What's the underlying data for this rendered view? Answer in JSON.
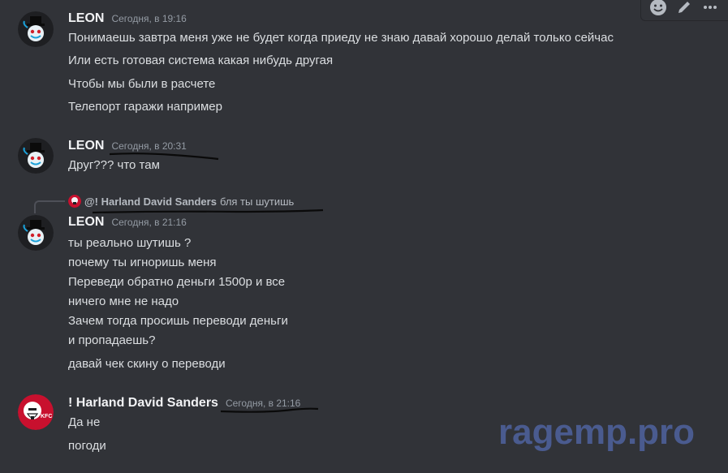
{
  "toolbar": {
    "icons": [
      "emoji-icon",
      "edit-icon",
      "more-icon"
    ]
  },
  "messages": [
    {
      "username": "LEON",
      "timestamp": "Сегодня, в 19:16",
      "lines": [
        "Понимаешь завтра меня уже не будет когда приеду не знаю давай хорошо делай только сейчас",
        "Или есть готовая система какая нибудь другая",
        "Чтобы мы были в расчете",
        "Телепорт гаражи например"
      ]
    },
    {
      "username": "LEON",
      "timestamp": "Сегодня, в 20:31",
      "lines": [
        "Друг??? что там"
      ]
    },
    {
      "reply": {
        "mention": "@! Harland David Sanders",
        "text": "бля ты шутишь"
      },
      "username": "LEON",
      "timestamp": "Сегодня, в 21:16",
      "lines": [
        "ты реально шутишь ?",
        "почему ты игноришь меня",
        "Переведи обратно деньги 1500р и все",
        "ничего мне не надо",
        "Зачем тогда просишь переводи деньги",
        "и пропадаешь?",
        "давай чек скину о переводи"
      ]
    },
    {
      "username": "! Harland David Sanders",
      "timestamp": "Сегодня, в 21:16",
      "avatar_text": "KFC",
      "lines": [
        "Да не",
        "погоди"
      ]
    }
  ],
  "watermark": "ragemp.pro",
  "colors": {
    "background": "#313338",
    "text": "#dbdee1",
    "muted": "#949ba4",
    "kfc_red": "#c8102e"
  }
}
